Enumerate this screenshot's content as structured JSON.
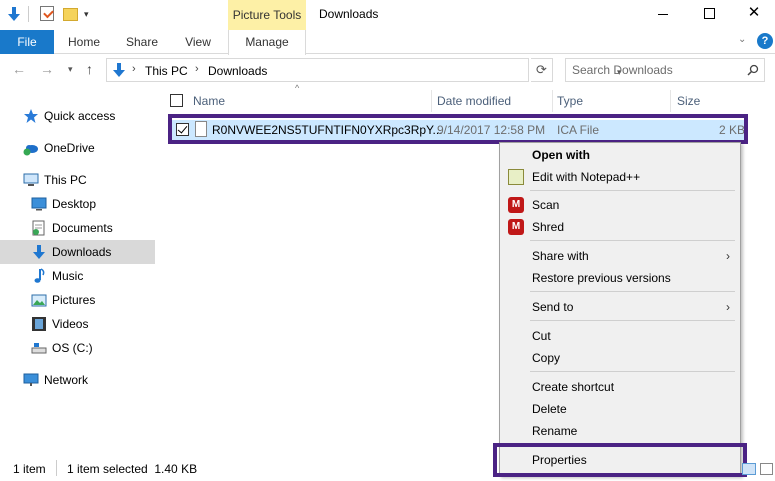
{
  "titlebar": {
    "title": "Downloads",
    "contextual_tab_group": "Picture Tools",
    "quick_access_toolbar": {
      "icons": [
        "download-arrow-icon",
        "properties-check-icon",
        "new-folder-icon"
      ],
      "dropdown": "▾"
    },
    "window_controls": {
      "close_glyph": "✕"
    }
  },
  "ribbon": {
    "tabs": [
      {
        "label": "File",
        "active": false
      },
      {
        "label": "Home",
        "active": false
      },
      {
        "label": "Share",
        "active": false
      },
      {
        "label": "View",
        "active": false
      },
      {
        "label": "Manage",
        "active": true
      }
    ],
    "expand_glyph": "⌄",
    "help_glyph": "?"
  },
  "navbar": {
    "back_glyph": "←",
    "forward_glyph": "→",
    "recent_glyph": "▾",
    "up_glyph": "↑",
    "breadcrumb": [
      "This PC",
      "Downloads"
    ],
    "breadcrumb_separator": "›",
    "address_dropdown": "▾",
    "refresh_glyph": "⟳",
    "search_placeholder": "Search Downloads"
  },
  "navigation_pane": {
    "items": [
      {
        "label": "Quick access",
        "icon": "star-icon"
      },
      {
        "label": "OneDrive",
        "icon": "cloud-icon"
      },
      {
        "label": "This PC",
        "icon": "computer-icon"
      },
      {
        "label": "Desktop",
        "icon": "desktop-icon"
      },
      {
        "label": "Documents",
        "icon": "documents-icon"
      },
      {
        "label": "Downloads",
        "icon": "download-icon",
        "selected": true
      },
      {
        "label": "Music",
        "icon": "music-note-icon"
      },
      {
        "label": "Pictures",
        "icon": "pictures-icon"
      },
      {
        "label": "Videos",
        "icon": "film-icon"
      },
      {
        "label": "OS (C:)",
        "icon": "drive-icon"
      },
      {
        "label": "Network",
        "icon": "network-icon"
      }
    ]
  },
  "file_list": {
    "columns": [
      "Name",
      "Date modified",
      "Type",
      "Size"
    ],
    "sort_glyph": "^",
    "rows": [
      {
        "name": "R0NVWEE2NS5TUFNTIFN0YXRpc3RpY...",
        "date_modified": "9/14/2017 12:58 PM",
        "type": "ICA File",
        "size": "2 KB",
        "selected": true,
        "checked": true
      }
    ]
  },
  "context_menu": {
    "items": [
      {
        "label": "Open with",
        "bold": true
      },
      {
        "label": "Edit with Notepad++",
        "icon": "notepad-plus-plus-icon"
      },
      {
        "label": "Scan",
        "icon": "mcafee-icon"
      },
      {
        "label": "Shred",
        "icon": "mcafee-icon"
      },
      {
        "label": "Share with",
        "submenu": true
      },
      {
        "label": "Restore previous versions"
      },
      {
        "label": "Send to",
        "submenu": true
      },
      {
        "label": "Cut"
      },
      {
        "label": "Copy"
      },
      {
        "label": "Create shortcut"
      },
      {
        "label": "Delete"
      },
      {
        "label": "Rename"
      },
      {
        "label": "Properties",
        "highlighted": true
      }
    ],
    "submenu_glyph": "›",
    "mcafee_glyph": "M"
  },
  "statusbar": {
    "item_count": "1 item",
    "selection": "1 item selected  1.40 KB"
  },
  "colors": {
    "file_tab": "#1979ca",
    "picture_tools": "#fdf0a6",
    "selection_row": "#cce8ff",
    "highlight_outline": "#4b2384",
    "column_header_text": "#4c607a"
  }
}
